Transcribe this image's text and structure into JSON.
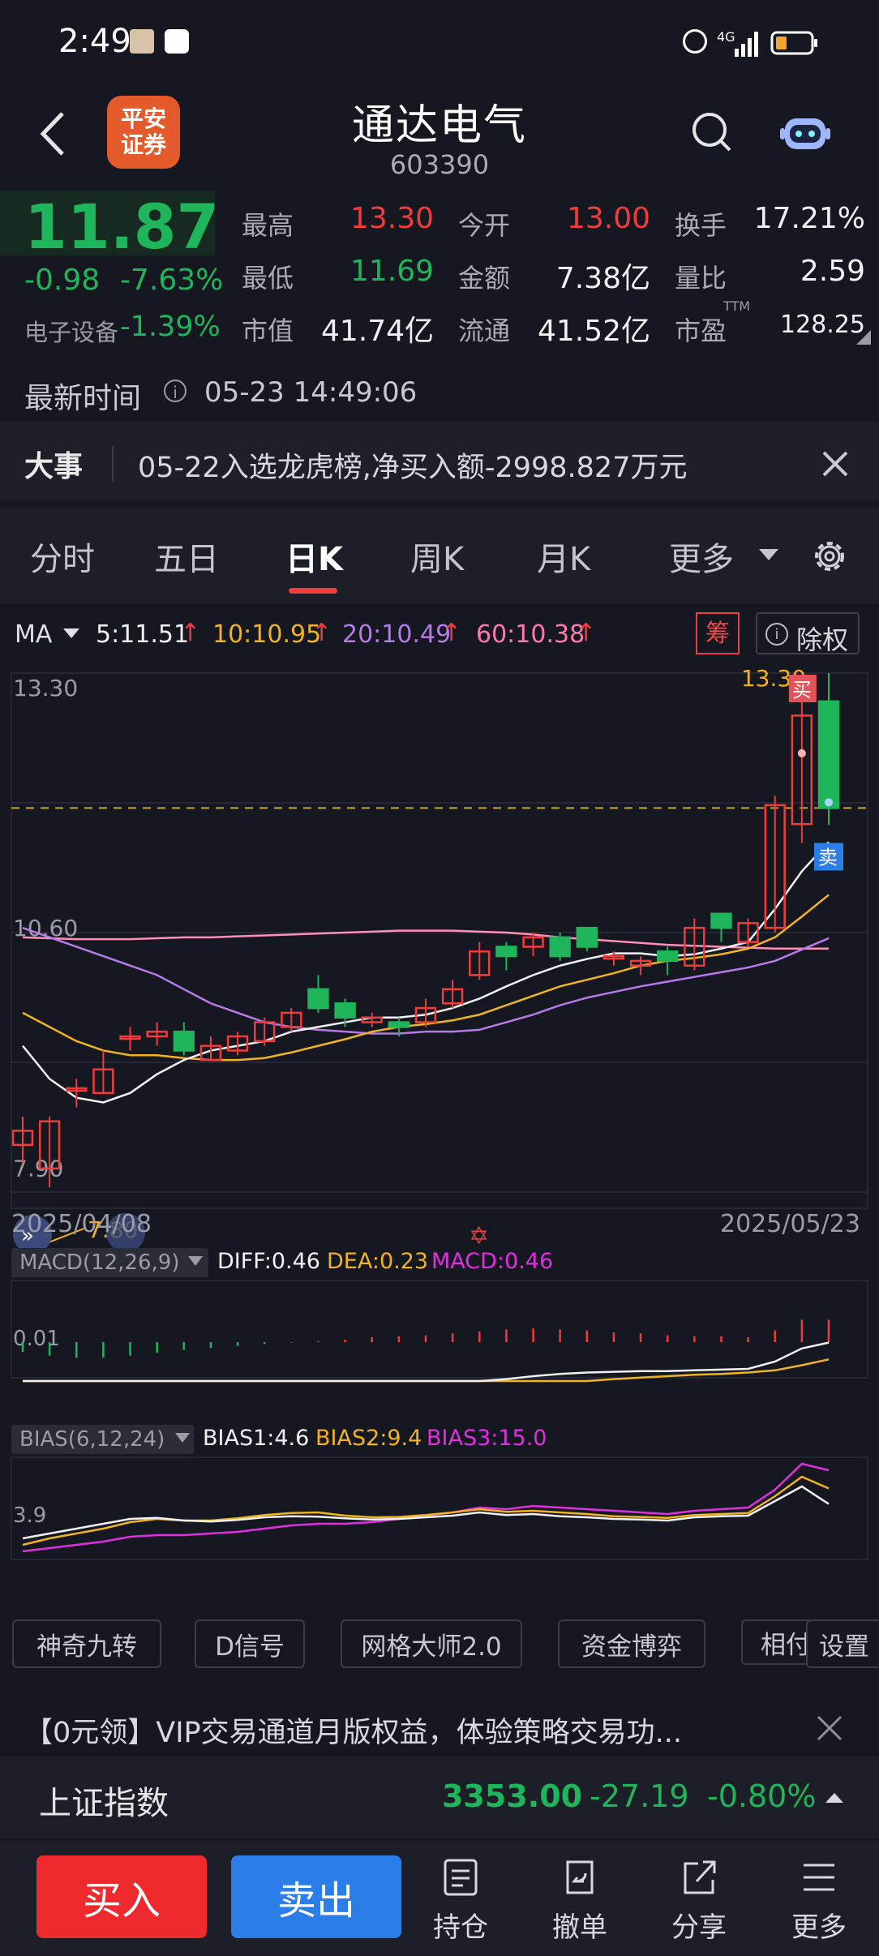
{
  "status": {
    "time": "2:49",
    "network": "4G"
  },
  "header": {
    "broker_line1": "平安",
    "broker_line2": "证券",
    "title": "通达电气",
    "code": "603390"
  },
  "quote": {
    "price": "11.87",
    "change": "-0.98",
    "change_pct": "-7.63%",
    "sector_name": "电子设备",
    "sector_pct": "-1.39%",
    "high_label": "最高",
    "high": "13.30",
    "open_label": "今开",
    "open": "13.00",
    "turnover_label": "换手",
    "turnover": "17.21%",
    "low_label": "最低",
    "low": "11.69",
    "amount_label": "金额",
    "amount": "7.38亿",
    "volratio_label": "量比",
    "volratio": "2.59",
    "mktcap_label": "市值",
    "mktcap": "41.74亿",
    "float_label": "流通",
    "float": "41.52亿",
    "pe_label": "市盈",
    "pe_sup": "TTM",
    "pe": "128.25"
  },
  "latest": {
    "label": "最新时间",
    "value": "05-23 14:49:06"
  },
  "news": {
    "tag": "大事",
    "text": "05-22入选龙虎榜,净买入额-2998.827万元"
  },
  "tabs": [
    "分时",
    "五日",
    "日K",
    "周K",
    "月K",
    "更多"
  ],
  "active_tab": "日K",
  "ma": {
    "label": "MA",
    "ma5": "5:11.51",
    "ma10": "10:10.95",
    "ma20": "20:10.49",
    "ma60": "60:10.38",
    "chip_label": "筹",
    "adjust_label": "除权"
  },
  "kchart": {
    "y_top": "13.30",
    "y_mid": "10.60",
    "y_bottom": "7.90",
    "high_mark": "13.30",
    "low_mark": "7.80",
    "buy_label": "买",
    "sell_label": "卖",
    "date_start": "2025/04/08",
    "date_end": "2025/05/23"
  },
  "macd": {
    "label": "MACD(12,26,9)",
    "diff": "DIFF:0.46",
    "dea": "DEA:0.23",
    "macd": "MACD:0.46",
    "axis": "0.01"
  },
  "bias": {
    "label": "BIAS(6,12,24)",
    "b1": "BIAS1:4.6",
    "b2": "BIAS2:9.4",
    "b3": "BIAS3:15.0",
    "axis": "3.9"
  },
  "tools": [
    "神奇九转",
    "D信号",
    "网格大师2.0",
    "资金博弈",
    "相付",
    "设置"
  ],
  "promo": {
    "text": "【0元领】VIP交易通道月版权益，体验策略交易功..."
  },
  "index": {
    "name": "上证指数",
    "value": "3353.00",
    "change": "-27.19",
    "pct": "-0.80%"
  },
  "bottom": {
    "buy": "买入",
    "sell": "卖出",
    "hold": "持仓",
    "cancel": "撤单",
    "share": "分享",
    "more": "更多"
  },
  "colors": {
    "up": "#f23b3b",
    "down": "#1fb55a",
    "bg": "#161821",
    "buy_btn": "#ee2a2f",
    "sell_btn": "#2b7de8"
  },
  "chart_data": {
    "type": "candlestick",
    "title": "",
    "ylim": [
      7.8,
      13.3
    ],
    "x_start": "2025/04/08",
    "x_end": "2025/05/23",
    "candles": [
      [
        8.3,
        8.45,
        8.6,
        8.1
      ],
      [
        8.05,
        8.55,
        8.6,
        7.85
      ],
      [
        8.9,
        8.9,
        9.0,
        8.7
      ],
      [
        8.85,
        9.1,
        9.3,
        8.85
      ],
      [
        9.45,
        9.45,
        9.55,
        9.3
      ],
      [
        9.45,
        9.5,
        9.6,
        9.35
      ],
      [
        9.5,
        9.3,
        9.6,
        9.25
      ],
      [
        9.2,
        9.35,
        9.45,
        9.2
      ],
      [
        9.3,
        9.45,
        9.5,
        9.25
      ],
      [
        9.4,
        9.6,
        9.65,
        9.35
      ],
      [
        9.55,
        9.7,
        9.75,
        9.5
      ],
      [
        9.95,
        9.75,
        10.1,
        9.7
      ],
      [
        9.8,
        9.65,
        9.85,
        9.55
      ],
      [
        9.6,
        9.65,
        9.7,
        9.55
      ],
      [
        9.6,
        9.55,
        9.65,
        9.45
      ],
      [
        9.6,
        9.75,
        9.85,
        9.55
      ],
      [
        9.8,
        9.95,
        10.05,
        9.75
      ],
      [
        10.1,
        10.35,
        10.45,
        10.05
      ],
      [
        10.4,
        10.3,
        10.45,
        10.15
      ],
      [
        10.4,
        10.5,
        10.55,
        10.3
      ],
      [
        10.5,
        10.3,
        10.55,
        10.25
      ],
      [
        10.6,
        10.4,
        10.6,
        10.35
      ],
      [
        10.3,
        10.3,
        10.35,
        10.2
      ],
      [
        10.2,
        10.25,
        10.3,
        10.1
      ],
      [
        10.35,
        10.25,
        10.4,
        10.1
      ],
      [
        10.2,
        10.6,
        10.7,
        10.15
      ],
      [
        10.75,
        10.6,
        10.75,
        10.45
      ],
      [
        10.45,
        10.65,
        10.7,
        10.4
      ],
      [
        10.6,
        11.9,
        12.0,
        10.55
      ],
      [
        11.7,
        12.85,
        13.0,
        11.5
      ],
      [
        13.0,
        11.87,
        13.3,
        11.69
      ]
    ],
    "ma5": [
      9.35,
      9.0,
      8.8,
      8.75,
      8.85,
      9.05,
      9.2,
      9.3,
      9.35,
      9.4,
      9.5,
      9.55,
      9.6,
      9.65,
      9.65,
      9.68,
      9.75,
      9.85,
      9.98,
      10.1,
      10.2,
      10.27,
      10.33,
      10.33,
      10.3,
      10.32,
      10.38,
      10.45,
      10.8,
      11.2,
      11.51
    ],
    "ma10": [
      9.7,
      9.55,
      9.4,
      9.3,
      9.25,
      9.25,
      9.22,
      9.2,
      9.2,
      9.22,
      9.28,
      9.35,
      9.42,
      9.5,
      9.55,
      9.58,
      9.62,
      9.68,
      9.78,
      9.88,
      9.98,
      10.05,
      10.12,
      10.2,
      10.25,
      10.28,
      10.32,
      10.38,
      10.5,
      10.72,
      10.95
    ],
    "ma20": [
      10.6,
      10.5,
      10.4,
      10.3,
      10.2,
      10.1,
      9.95,
      9.8,
      9.7,
      9.6,
      9.55,
      9.52,
      9.5,
      9.48,
      9.48,
      9.5,
      9.5,
      9.52,
      9.6,
      9.68,
      9.78,
      9.86,
      9.92,
      9.98,
      10.03,
      10.08,
      10.13,
      10.18,
      10.25,
      10.37,
      10.49
    ],
    "ma60": [
      10.5,
      10.49,
      10.48,
      10.48,
      10.48,
      10.49,
      10.5,
      10.5,
      10.51,
      10.52,
      10.53,
      10.54,
      10.55,
      10.56,
      10.57,
      10.57,
      10.57,
      10.56,
      10.55,
      10.53,
      10.5,
      10.48,
      10.46,
      10.44,
      10.42,
      10.41,
      10.4,
      10.39,
      10.38,
      10.38,
      10.38
    ],
    "macd_diff": [
      -0.2,
      -0.28,
      -0.34,
      -0.38,
      -0.39,
      -0.39,
      -0.38,
      -0.37,
      -0.36,
      -0.34,
      -0.32,
      -0.3,
      -0.27,
      -0.24,
      -0.21,
      -0.18,
      -0.14,
      -0.09,
      -0.04,
      0.0,
      0.03,
      0.05,
      0.06,
      0.07,
      0.07,
      0.08,
      0.09,
      0.1,
      0.2,
      0.38,
      0.46
    ],
    "macd_dea": [
      -0.1,
      -0.14,
      -0.18,
      -0.22,
      -0.25,
      -0.28,
      -0.3,
      -0.31,
      -0.32,
      -0.32,
      -0.32,
      -0.31,
      -0.3,
      -0.29,
      -0.27,
      -0.25,
      -0.23,
      -0.2,
      -0.17,
      -0.14,
      -0.1,
      -0.07,
      -0.04,
      -0.02,
      0.0,
      0.02,
      0.03,
      0.05,
      0.08,
      0.15,
      0.23
    ],
    "macd_hist": [
      -0.2,
      -0.28,
      -0.32,
      -0.32,
      -0.28,
      -0.22,
      -0.16,
      -0.12,
      -0.08,
      -0.04,
      -0.01,
      0.02,
      0.05,
      0.1,
      0.12,
      0.14,
      0.18,
      0.22,
      0.26,
      0.28,
      0.26,
      0.24,
      0.2,
      0.18,
      0.14,
      0.12,
      0.12,
      0.1,
      0.24,
      0.46,
      0.46
    ],
    "bias1": [
      -6,
      -4.5,
      -3,
      -1.5,
      0,
      0.3,
      -0.5,
      -0.8,
      -0.3,
      0.5,
      0.8,
      0.7,
      0.2,
      -0.2,
      0,
      0.5,
      1,
      2,
      1.2,
      1.5,
      0.8,
      0.5,
      0,
      -0.2,
      -0.5,
      0.5,
      0.8,
      1,
      5.5,
      10,
      4.6
    ],
    "bias2": [
      -8,
      -6,
      -4.5,
      -3,
      -1,
      0,
      -0.5,
      -0.5,
      0.2,
      1.2,
      1.8,
      2,
      1,
      0.5,
      0.6,
      1.2,
      2,
      3,
      2.2,
      2.5,
      2,
      1.5,
      0.8,
      0.6,
      0.3,
      1.2,
      1.5,
      1.8,
      7,
      13,
      9.4
    ],
    "bias3": [
      -10,
      -9,
      -8,
      -7,
      -5.5,
      -5,
      -5,
      -4.5,
      -4,
      -3,
      -2,
      -1.5,
      -1.5,
      -1,
      0,
      1,
      2,
      3.5,
      3,
      4,
      3.5,
      3,
      2.5,
      2,
      1.5,
      2.5,
      3,
      3.5,
      9,
      17,
      15.0
    ]
  }
}
